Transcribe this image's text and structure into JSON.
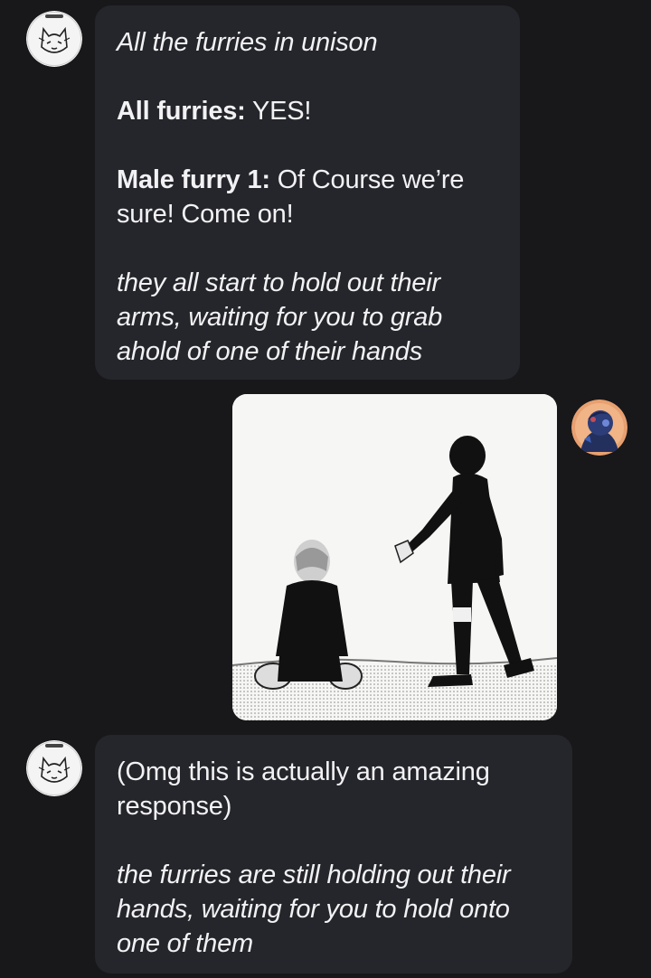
{
  "messages": [
    {
      "sender": "bot",
      "lines": [
        {
          "italic": "All the furries in unison"
        },
        {
          "bold": "All furries:",
          "text": " YES!"
        },
        {
          "bold": "Male furry 1:",
          "text": " Of Course we’re sure! Come on!"
        },
        {
          "italic": "they all start to hold out their arms, waiting for you to grab ahold of one of their hands"
        }
      ]
    },
    {
      "sender": "user",
      "attachment": "manga-panel-image"
    },
    {
      "sender": "bot",
      "lines": [
        {
          "text": "(Omg this is actually an amazing response)"
        },
        {
          "italic": "the furries are still holding out their hands, waiting for you to hold onto one of them"
        }
      ]
    }
  ],
  "icons": {
    "bot_avatar": "fox-furry-avatar-icon",
    "user_avatar": "blue-character-avatar-icon"
  },
  "colors": {
    "background": "#18181a",
    "bubble": "#25262b",
    "text": "#f2f2f4"
  }
}
